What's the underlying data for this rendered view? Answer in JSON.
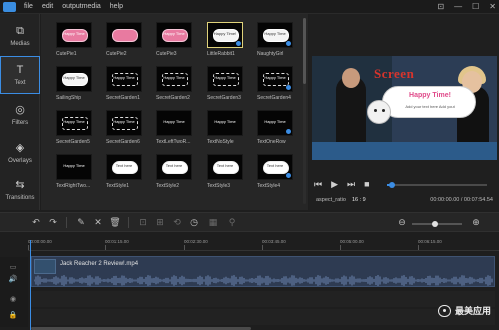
{
  "menu": {
    "items": [
      "file",
      "edit",
      "outputmedia",
      "help"
    ]
  },
  "window": {
    "controls": [
      "⊡",
      "—",
      "☐",
      "✕"
    ]
  },
  "sidebar": {
    "items": [
      {
        "label": "Medias",
        "icon": "media-icon",
        "glyph": "⧉"
      },
      {
        "label": "Text",
        "icon": "text-icon",
        "glyph": "T"
      },
      {
        "label": "Filters",
        "icon": "filters-icon",
        "glyph": "◎"
      },
      {
        "label": "Overlays",
        "icon": "overlays-icon",
        "glyph": "◈"
      },
      {
        "label": "Transitions",
        "icon": "transitions-icon",
        "glyph": "⇆"
      }
    ],
    "active": "Text"
  },
  "library": {
    "items": [
      {
        "label": "CutePie1",
        "style": "pink",
        "text": "Happy Time"
      },
      {
        "label": "CutePie2",
        "style": "pink",
        "text": ""
      },
      {
        "label": "CutePie3",
        "style": "pink",
        "text": "Happy Time"
      },
      {
        "label": "LittleRabbit1",
        "style": "white",
        "text": "Happy Time!"
      },
      {
        "label": "NaughtyGirl",
        "style": "white",
        "text": "Happy Time"
      },
      {
        "label": "SailingShip",
        "style": "white",
        "text": "Happy Time"
      },
      {
        "label": "SecretGarden1",
        "style": "frame",
        "text": "Happy Time"
      },
      {
        "label": "SecretGarden2",
        "style": "frame",
        "text": "Happy Time"
      },
      {
        "label": "SecretGarden3",
        "style": "frame",
        "text": "Happy Time"
      },
      {
        "label": "SecretGarden4",
        "style": "frame",
        "text": "Happy Time"
      },
      {
        "label": "SecretGarden5",
        "style": "frame",
        "text": "Happy Time"
      },
      {
        "label": "SecretGarden6",
        "style": "frame",
        "text": "Happy Time"
      },
      {
        "label": "TextLeftTwoR...",
        "style": "none",
        "text": "Happy Time"
      },
      {
        "label": "TextNoStyle",
        "style": "none",
        "text": "Happy Time"
      },
      {
        "label": "TextOneRow",
        "style": "none",
        "text": "Happy Time"
      },
      {
        "label": "TextRightTwo...",
        "style": "none",
        "text": "Happy Time"
      },
      {
        "label": "TextStyle1",
        "style": "cloud",
        "text": "Text here"
      },
      {
        "label": "TextStyle2",
        "style": "cloud",
        "text": "Text here"
      },
      {
        "label": "TextStyle3",
        "style": "cloud",
        "text": "Text here"
      },
      {
        "label": "TextStyle4",
        "style": "cloud",
        "text": "Text here"
      }
    ],
    "selected": "LittleRabbit1"
  },
  "preview": {
    "screen_text": "Screen",
    "bubble_title": "Happy Time!",
    "bubble_sub": "Add your text here Add yout",
    "aspect_label": "aspect_ratio",
    "aspect_value": "16 : 9",
    "timecode": "00:00:00.00 / 00:07:54.54",
    "progress": 0.05,
    "transport": [
      "⏮",
      "▶",
      "⏭",
      "■"
    ]
  },
  "toolbar": {
    "zoom_out": "⊖",
    "zoom_in": "⊕",
    "zoom_level": 0.45
  },
  "timeline": {
    "ticks": [
      "00:00:00.00",
      "00:01:15.00",
      "00:02:30.00",
      "00:03:45.00",
      "00:05:00.00",
      "00:06:15.00"
    ],
    "clip_name": "Jack Reacher 2 Review!.mp4"
  },
  "watermark": {
    "text": "最美应用"
  },
  "colors": {
    "accent": "#3b8de4",
    "background": "#1e1e1e",
    "selected_border": "#e0d37a"
  }
}
